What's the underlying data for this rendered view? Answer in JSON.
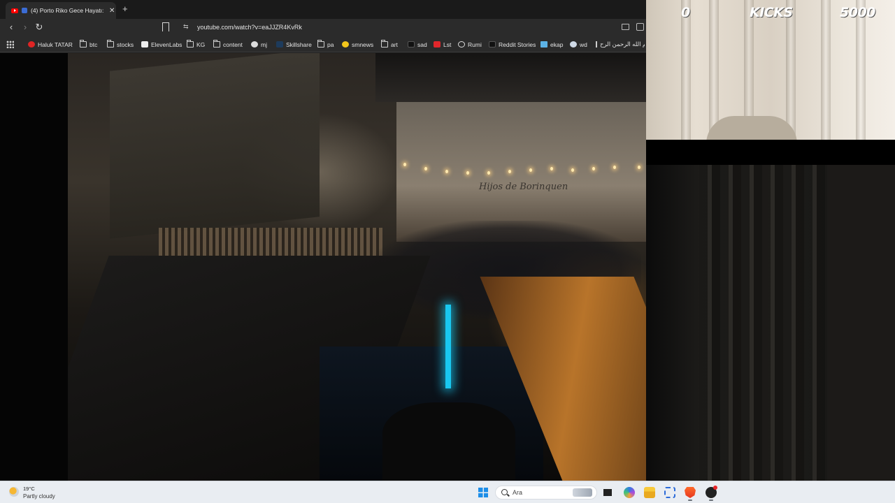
{
  "browser": {
    "tab": {
      "title": "(4) Porto Riko Gece Hayatı: G",
      "close": "✕"
    },
    "new_tab": "+",
    "nav": {
      "back": "‹",
      "forward": "›",
      "reload": "↻"
    },
    "site_info": "⇆",
    "url": "youtube.com/watch?v=eaJJZR4KvRk",
    "bookmarks": [
      {
        "label": "Haluk TATAR",
        "icon": "youtube-icon"
      },
      {
        "label": "btc",
        "icon": "folder-icon"
      },
      {
        "label": "stocks",
        "icon": "folder-icon"
      },
      {
        "label": "ElevenLabs",
        "icon": "elevenlabs-icon"
      },
      {
        "label": "KG",
        "icon": "folder-icon"
      },
      {
        "label": "content",
        "icon": "folder-icon"
      },
      {
        "label": "mj",
        "icon": "github-icon"
      },
      {
        "label": "Skillshare",
        "icon": "skillshare-icon"
      },
      {
        "label": "pa",
        "icon": "folder-icon"
      },
      {
        "label": "smnews",
        "icon": "smiley-icon"
      },
      {
        "label": "art",
        "icon": "folder-icon"
      },
      {
        "label": "sad",
        "icon": "cursor-icon"
      },
      {
        "label": "Lst",
        "icon": "s-icon"
      },
      {
        "label": "Rumi",
        "icon": "globe-icon"
      },
      {
        "label": "Reddit Stories",
        "icon": "d-icon"
      },
      {
        "label": "ekap",
        "icon": "ekap-icon"
      },
      {
        "label": "wd",
        "icon": "wd-icon"
      },
      {
        "label": "بسم الله الرحمن الرح...",
        "icon": "document-icon"
      }
    ]
  },
  "video": {
    "sign_text": "Hijos de Borinquen"
  },
  "overlay": {
    "kicks_current": "0",
    "kicks_label": "KICKS",
    "kicks_goal": "5000"
  },
  "taskbar": {
    "weather_temp": "19°C",
    "weather_desc": "Partly cloudy",
    "search_label": "Ara"
  },
  "colors": {
    "accent": "#1d8ee8",
    "youtube_red": "#ff0000",
    "cyan_light": "#19c7f0"
  }
}
